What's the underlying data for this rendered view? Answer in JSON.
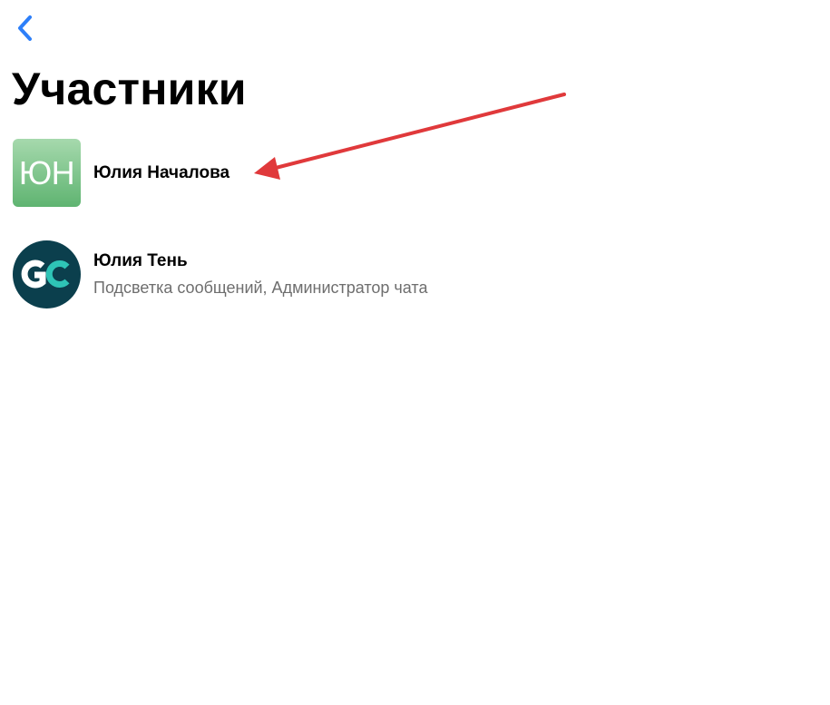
{
  "header": {
    "back_icon": "chevron-left-icon",
    "title": "Участники"
  },
  "members": [
    {
      "name": "Юлия Началова",
      "avatar_initials": "ЮН",
      "role": ""
    },
    {
      "name": "Юлия Тень",
      "avatar_logo": "GC",
      "role": "Подсветка сообщений, Администратор чата"
    }
  ],
  "colors": {
    "accent": "#2d7ff9",
    "annotation_arrow": "#e0393b",
    "avatar_green_top": "#a6d9ad",
    "avatar_green_bottom": "#5fb471",
    "logo_background": "#0b3f4d",
    "logo_accent": "#2ec4b6"
  }
}
